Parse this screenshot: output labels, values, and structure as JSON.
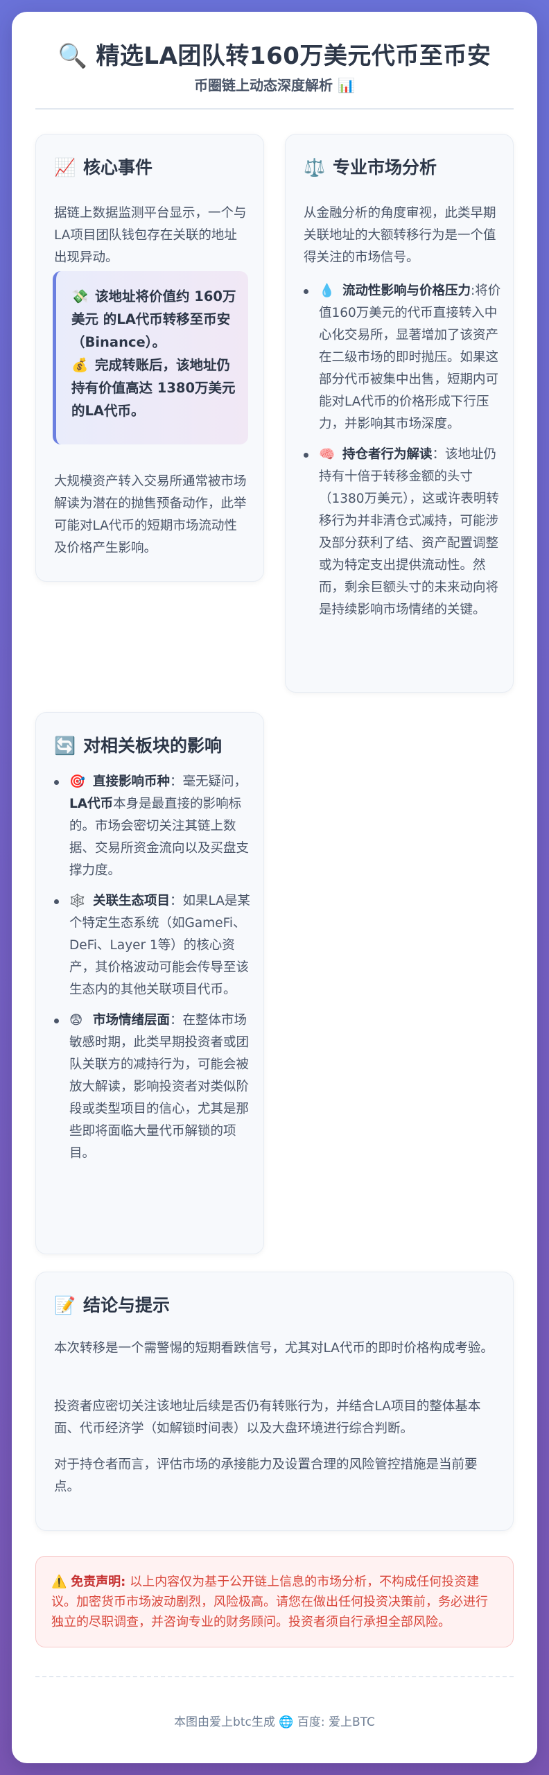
{
  "header": {
    "title_icon": "🔍",
    "title": "精选LA团队转160万美元代币至币安",
    "subtitle": "币圈链上动态深度解析 📊"
  },
  "core_event": {
    "icon": "📈",
    "title": "核心事件",
    "intro": "据链上数据监测平台显示，一个与LA项目团队钱包存在关联的地址出现异动。",
    "highlight_1_icon": "💸",
    "highlight_1": "该地址将价值约 160万美元 的LA代币转移至币安（Binance）。",
    "highlight_2_icon": "💰",
    "highlight_2": "完成转账后，该地址仍持有价值高达 1380万美元 的LA代币。",
    "outro": "大规模资产转入交易所通常被市场解读为潜在的抛售预备动作，此举可能对LA代币的短期市场流动性及价格产生影响。"
  },
  "market_analysis": {
    "icon": "⚖️",
    "title": "专业市场分析",
    "intro": "从金融分析的角度审视，此类早期关联地址的大额转移行为是一个值得关注的市场信号。",
    "items": [
      {
        "icon": "💧",
        "label": "流动性影响与价格压力",
        "sep": ":",
        "text": "将价值160万美元的代币直接转入中心化交易所，显著增加了该资产在二级市场的即时抛压。如果这部分代币被集中出售，短期内可能对LA代币的价格形成下行压力，并影响其市场深度。"
      },
      {
        "icon": "🧠",
        "label": "持仓者行为解读",
        "sep": "：",
        "text": "该地址仍持有十倍于转移金额的头寸（1380万美元），这或许表明转移行为并非清仓式减持，可能涉及部分获利了结、资产配置调整或为特定支出提供流动性。然而，剩余巨额头寸的未来动向将是持续影响市场情绪的关键。"
      }
    ]
  },
  "sector_impact": {
    "icon": "🔄",
    "title": "对相关板块的影响",
    "items": [
      {
        "icon": "🎯",
        "label": "直接影响币种",
        "sep": "：",
        "text_a": "毫无疑问，",
        "bold_mid": "LA代币",
        "text_b": "本身是最直接的影响标的。市场会密切关注其链上数据、交易所资金流向以及买盘支撑力度。"
      },
      {
        "icon": "🕸️",
        "label": "关联生态项目",
        "sep": "：",
        "text_a": "如果LA是某个特定生态系统（如GameFi、DeFi、Layer 1等）的核心资产，其价格波动可能会传导至该生态内的其他关联项目代币。",
        "bold_mid": "",
        "text_b": ""
      },
      {
        "icon": "😨",
        "label": "市场情绪层面",
        "sep": "：",
        "text_a": "在整体市场敏感时期，此类早期投资者或团队关联方的减持行为，可能会被放大解读，影响投资者对类似阶段或类型项目的信心，尤其是那些即将面临大量代币解锁的项目。",
        "bold_mid": "",
        "text_b": ""
      }
    ]
  },
  "conclusion": {
    "icon": "📝",
    "title": "结论与提示",
    "paragraphs": [
      "本次转移是一个需警惕的短期看跌信号，尤其对LA代币的即时价格构成考验。",
      "投资者应密切关注该地址后续是否仍有转账行为，并结合LA项目的整体基本面、代币经济学（如解锁时间表）以及大盘环境进行综合判断。",
      "对于持仓者而言，评估市场的承接能力及设置合理的风险管控措施是当前要点。"
    ]
  },
  "disclaimer": {
    "icon": "⚠️",
    "label": "免责声明:",
    "text": "以上内容仅为基于公开链上信息的市场分析，不构成任何投资建议。加密货币市场波动剧烈，风险极高。请您在做出任何投资决策前，务必进行独立的尽职调查，并咨询专业的财务顾问。投资者须自行承担全部风险。"
  },
  "footer": {
    "text_1": "本图由爱上btc生成",
    "icon": "🌐",
    "text_2": "百度: 爱上BTC"
  }
}
